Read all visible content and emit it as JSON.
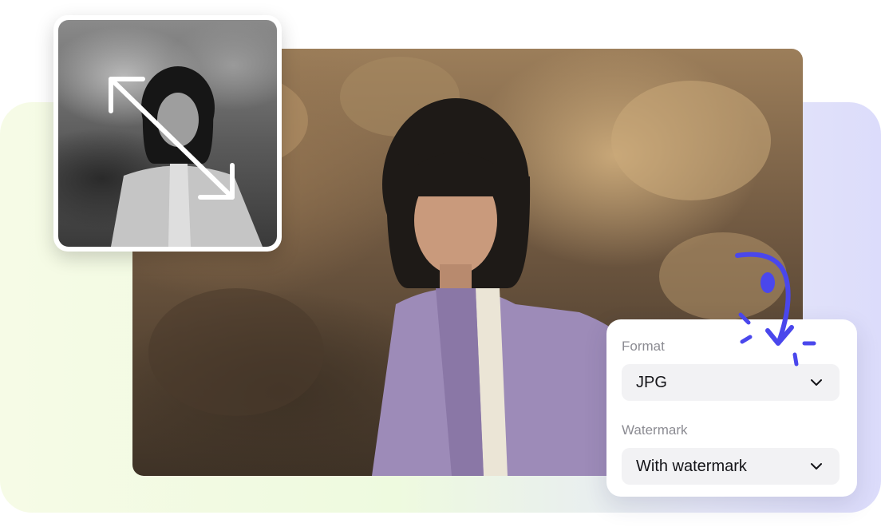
{
  "icons": {
    "resize": "diagonal-resize-arrows-icon",
    "chevron": "chevron-down-icon",
    "doodle": "curved-arrow-icon"
  },
  "colors": {
    "accent": "#4a47ec",
    "panel_bg": "#ffffff",
    "select_bg": "#f2f2f4",
    "label_text": "#8b8b92",
    "value_text": "#141418"
  },
  "settings": {
    "format": {
      "label": "Format",
      "value": "JPG"
    },
    "watermark": {
      "label": "Watermark",
      "value": "With watermark"
    }
  }
}
